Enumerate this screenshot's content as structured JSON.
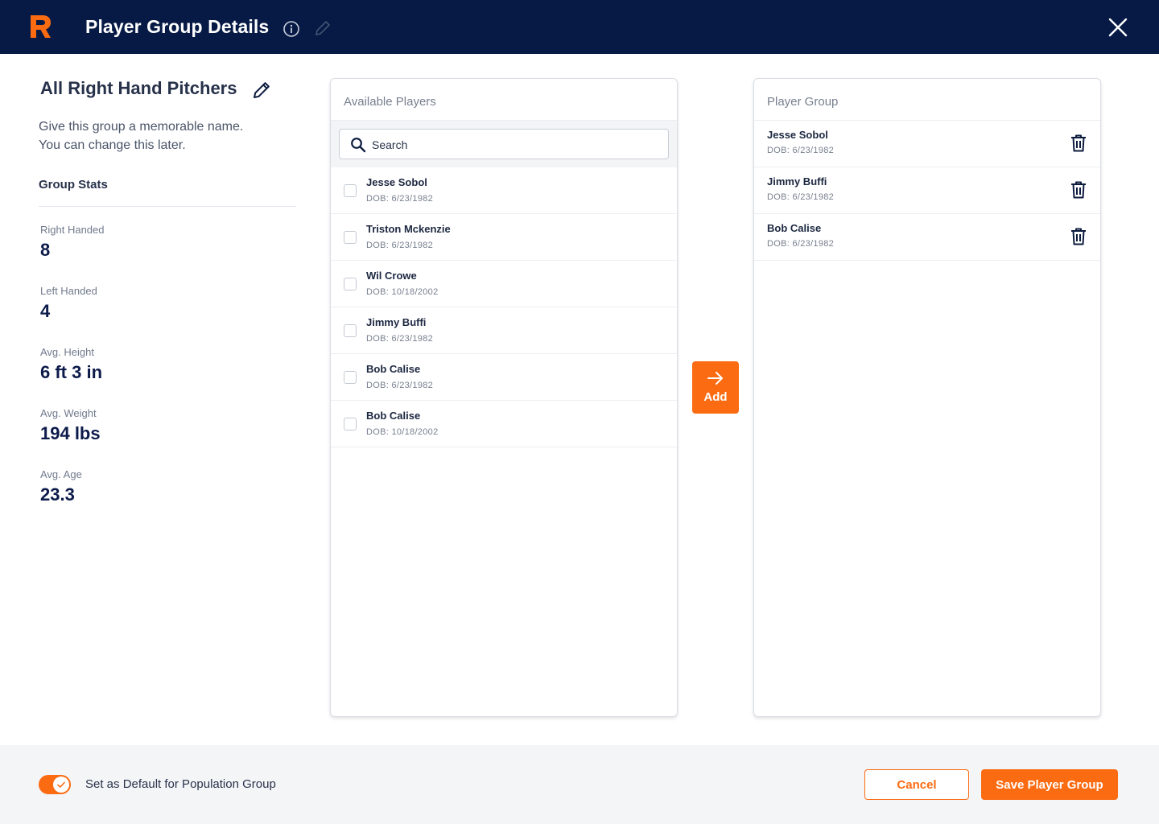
{
  "header": {
    "title": "Player Group Details",
    "logo_icon": "r-logo-icon",
    "info_icon": "info-icon",
    "edit_icon": "pencil-icon",
    "close_icon": "close-icon"
  },
  "group": {
    "name": "All Right Hand Pitchers",
    "hint_line1": "Give this group a memorable name.",
    "hint_line2": "You can change this later."
  },
  "stats": {
    "title": "Group Stats",
    "items": [
      {
        "label": "Right Handed",
        "value": "8"
      },
      {
        "label": "Left Handed",
        "value": "4"
      },
      {
        "label": "Avg. Height",
        "value": "6 ft 3 in"
      },
      {
        "label": "Avg. Weight",
        "value": "194 lbs"
      },
      {
        "label": "Avg. Age",
        "value": "23.3"
      }
    ]
  },
  "available": {
    "title": "Available Players",
    "search_placeholder": "Search",
    "players": [
      {
        "name": "Jesse Sobol",
        "dob": "DOB: 6/23/1982"
      },
      {
        "name": "Triston Mckenzie",
        "dob": "DOB: 6/23/1982"
      },
      {
        "name": "Wil Crowe",
        "dob": "DOB: 10/18/2002"
      },
      {
        "name": "Jimmy Buffi",
        "dob": "DOB: 6/23/1982"
      },
      {
        "name": "Bob Calise",
        "dob": "DOB: 6/23/1982"
      },
      {
        "name": "Bob Calise",
        "dob": "DOB: 10/18/2002"
      }
    ]
  },
  "add_button": {
    "label": "Add"
  },
  "player_group": {
    "title": "Player Group",
    "players": [
      {
        "name": "Jesse Sobol",
        "dob": "DOB: 6/23/1982"
      },
      {
        "name": "Jimmy Buffi",
        "dob": "DOB: 6/23/1982"
      },
      {
        "name": "Bob Calise",
        "dob": "DOB: 6/23/1982"
      }
    ]
  },
  "footer": {
    "toggle_label": "Set as Default for Population Group",
    "toggle_on": true,
    "cancel_label": "Cancel",
    "save_label": "Save Player Group"
  },
  "colors": {
    "header_bg": "#061a45",
    "accent": "#fb6b12",
    "stat_value": "#0d1b4b"
  }
}
